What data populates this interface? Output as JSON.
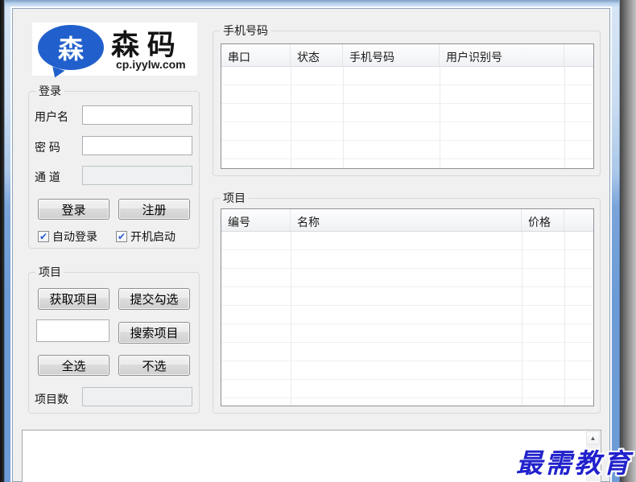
{
  "icons": {
    "check": "✔",
    "scroll_up": "▲"
  },
  "logo": {
    "bubble_char": "森",
    "name": "森 码",
    "site": "cp.iyylw.com"
  },
  "login": {
    "label": "登录",
    "username_label": "用户名",
    "username_value": "",
    "password_label": "密 码",
    "password_value": "",
    "channel_label": "通 道",
    "channel_value": "",
    "login_button": "登录",
    "register_button": "注册",
    "auto_login_label": "自动登录",
    "auto_start_label": "开机启动"
  },
  "project_panel": {
    "label": "项目",
    "get_button": "获取项目",
    "submit_button": "提交勾选",
    "search_value": "",
    "search_button": "搜索项目",
    "select_all_button": "全选",
    "select_none_button": "不选",
    "count_label": "项目数",
    "count_value": ""
  },
  "phone_table": {
    "label": "手机号码",
    "columns": [
      "串口",
      "状态",
      "手机号码",
      "用户识别号"
    ],
    "rows": []
  },
  "project_table": {
    "label": "项目",
    "columns": [
      "编号",
      "名称",
      "价格"
    ],
    "rows": []
  },
  "log": {
    "value": ""
  },
  "watermark": {
    "text": "最需教育"
  },
  "colors": {
    "brand_blue": "#2160cc",
    "glass_blue": "#6d9cd6",
    "watermark_blue": "#2121cc",
    "client_bg": "#f0f0f0"
  }
}
